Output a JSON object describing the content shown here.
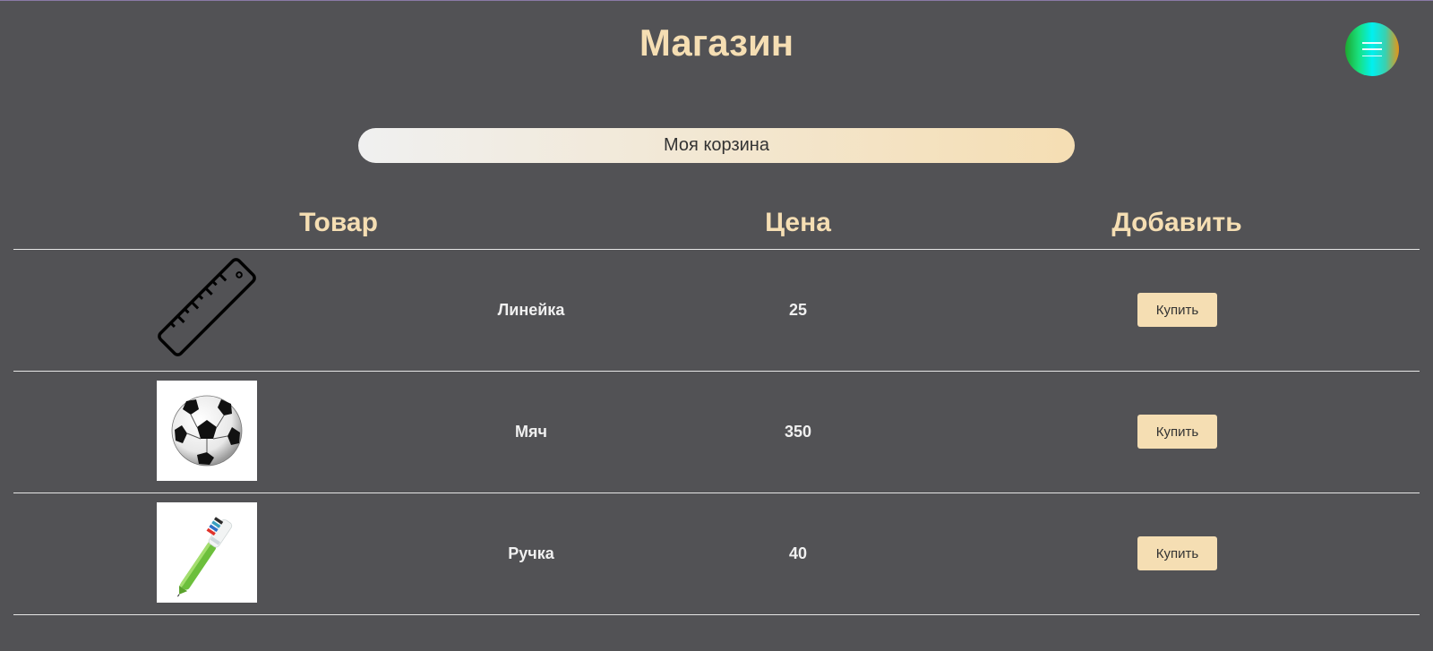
{
  "header": {
    "title": "Магазин",
    "menu_icon": "hamburger-menu-icon"
  },
  "cart": {
    "label": "Моя корзина"
  },
  "table": {
    "columns": [
      "Товар",
      "Цена",
      "Добавить"
    ],
    "rows": [
      {
        "name": "Линейка",
        "price": "25",
        "buy_label": "Купить",
        "image": "ruler-icon"
      },
      {
        "name": "Мяч",
        "price": "350",
        "buy_label": "Купить",
        "image": "soccer-ball-image"
      },
      {
        "name": "Ручка",
        "price": "40",
        "buy_label": "Купить",
        "image": "pen-image"
      }
    ]
  },
  "colors": {
    "background": "#525255",
    "accent": "#f5deb3",
    "divider": "#e6e6e6"
  }
}
